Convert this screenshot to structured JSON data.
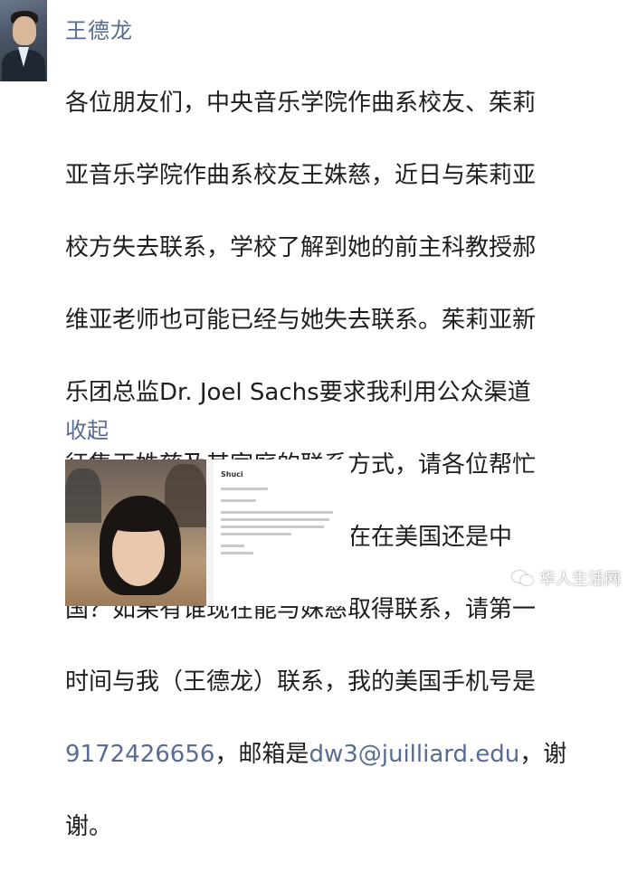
{
  "post": {
    "author": "王德龙",
    "message_lines": [
      "各位朋友们，中央音乐学院作曲系校友、茱莉",
      "亚音乐学院作曲系校友王姝慈，近日与茱莉亚",
      "校方失去联系，学校了解到她的前主科教授郝",
      "维亚老师也可能已经与她失去联系。茱莉亚新",
      "乐团总监Dr. Joel Sachs要求我利用公众渠道",
      "征集王姝慈及其家庭的联系方式，请各位帮忙",
      "转发！是否有人知道姝慈现在在美国还是中",
      "国？如果有谁现在能与姝慈取得联系，请第一",
      "时间与我（王德龙）联系，我的美国手机号是"
    ],
    "phone": "9172426656",
    "mid_text": "，邮箱是",
    "email": "dw3@juilliard.edu",
    "tail_text": "，谢",
    "last_line": "谢。",
    "collapse_label": "收起"
  },
  "attachment": {
    "letter_title": "Shuci"
  },
  "watermark": {
    "label": "华人生活网",
    "icon": "wechat-icon"
  }
}
